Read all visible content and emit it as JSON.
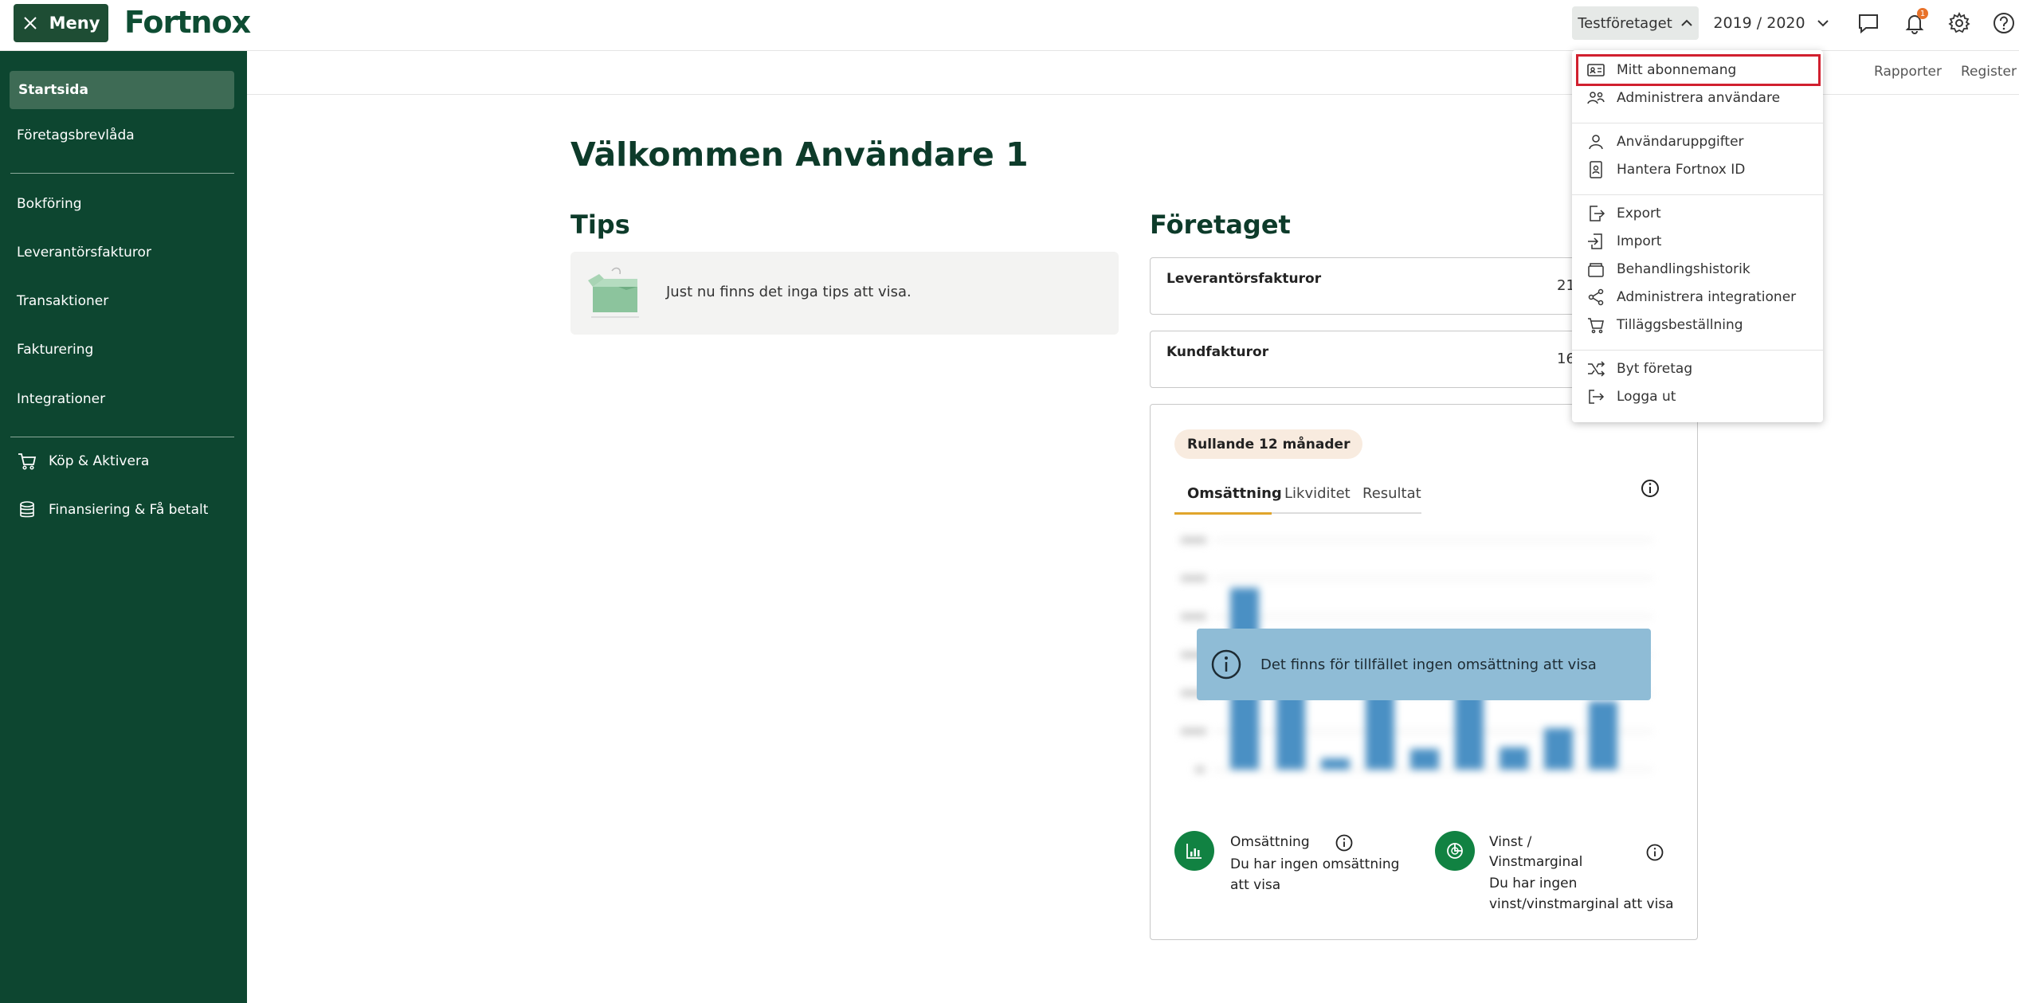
{
  "header": {
    "menu_label": "Meny",
    "logo_text": "Fortnox",
    "company_name": "Testföretaget",
    "fiscal_year": "2019 / 2020",
    "notification_count": "1",
    "accent_color": "#1e4d34"
  },
  "subnav": {
    "rapporter": "Rapporter",
    "register": "Register"
  },
  "sidebar": {
    "active_item": "Startsida",
    "items": [
      {
        "label": "Företagsbrevlåda"
      },
      {
        "label": "Bokföring"
      },
      {
        "label": "Leverantörsfakturor"
      },
      {
        "label": "Transaktioner"
      },
      {
        "label": "Fakturering"
      },
      {
        "label": "Integrationer"
      },
      {
        "label": "Köp & Aktivera",
        "icon": "cart-icon"
      },
      {
        "label": "Finansiering & Få betalt",
        "icon": "coins-icon"
      }
    ]
  },
  "main": {
    "welcome": "Välkommen Användare 1",
    "tips_title": "Tips",
    "tips_empty_text": "Just nu finns det inga tips att visa.",
    "company_title": "Företaget",
    "stats": [
      {
        "label": "Leverantörsfakturor",
        "value": "21"
      },
      {
        "label": "Kundfakturor",
        "value": "16"
      }
    ],
    "chart_card": {
      "badge": "Rullande 12 månader",
      "tabs": [
        "Omsättning",
        "Likviditet",
        "Resultat"
      ],
      "active_tab": "Omsättning",
      "no_data_text": "Det finns för tillfället ingen omsättning att visa",
      "kpis": [
        {
          "title": "Omsättning",
          "text": "Du har ingen omsättning att visa",
          "icon": "bar-chart-icon"
        },
        {
          "title": "Vinst / Vinstmarginal",
          "text": "Du har ingen vinst/vinstmarginal att visa",
          "icon": "pie-chart-icon"
        }
      ]
    }
  },
  "dropdown": {
    "groups": [
      [
        {
          "label": "Mitt abonnemang",
          "icon": "id-card-icon"
        },
        {
          "label": "Administrera användare",
          "icon": "users-icon"
        }
      ],
      [
        {
          "label": "Användaruppgifter",
          "icon": "user-icon"
        },
        {
          "label": "Hantera Fortnox ID",
          "icon": "badge-icon"
        }
      ],
      [
        {
          "label": "Export",
          "icon": "export-icon"
        },
        {
          "label": "Import",
          "icon": "import-icon"
        },
        {
          "label": "Behandlingshistorik",
          "icon": "folder-icon"
        },
        {
          "label": "Administrera integrationer",
          "icon": "share-icon"
        },
        {
          "label": "Tilläggsbeställning",
          "icon": "cart-icon"
        }
      ],
      [
        {
          "label": "Byt företag",
          "icon": "shuffle-icon"
        },
        {
          "label": "Logga ut",
          "icon": "logout-icon"
        }
      ]
    ],
    "highlighted_item": "Mitt abonnemang",
    "highlight_color": "#d1202f"
  }
}
